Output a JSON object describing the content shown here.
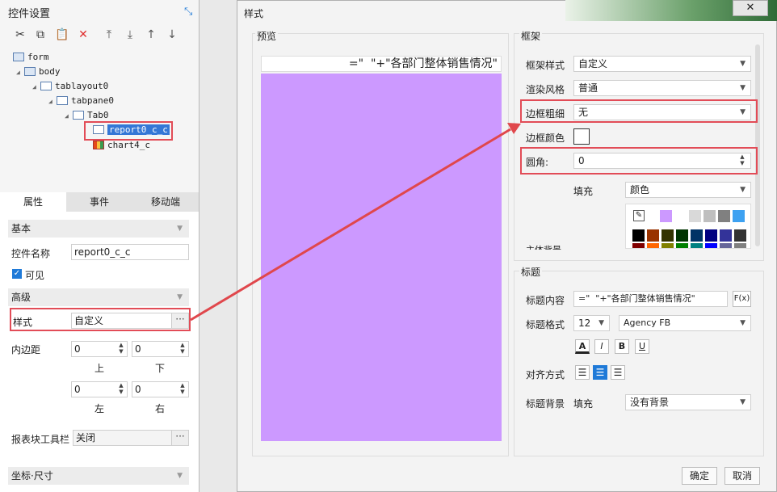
{
  "left_panel": {
    "title": "控件设置",
    "toolbar": [
      "cut",
      "copy",
      "paste",
      "delete",
      "move-top",
      "move-bottom",
      "move-up",
      "move-down"
    ],
    "tree": [
      {
        "label": "form"
      },
      {
        "label": "body"
      },
      {
        "label": "tablayout0"
      },
      {
        "label": "tabpane0"
      },
      {
        "label": "Tab0"
      },
      {
        "label": "report0_c_c"
      },
      {
        "label": "chart4_c"
      }
    ],
    "tabs": [
      "属性",
      "事件",
      "移动端"
    ],
    "sections": {
      "basic": "基本",
      "advanced": "高级",
      "coord": "坐标·尺寸"
    },
    "name_label": "控件名称",
    "name_value": "report0_c_c",
    "visible_label": "可见",
    "style_label": "样式",
    "style_value": "自定义",
    "padding_label": "内边距",
    "padding": {
      "top": "0",
      "bottom": "0",
      "left": "0",
      "right": "0"
    },
    "padding_labels": {
      "top": "上",
      "bottom": "下",
      "left": "左",
      "right": "右"
    },
    "toolbar_label": "报表块工具栏",
    "toolbar_value": "关闭",
    "dots": "···"
  },
  "dialog": {
    "title": "样式",
    "close": "✕",
    "preview": {
      "label": "预览",
      "title_text": "=\"  \"+\"各部门整体销售情况\"",
      "fill": "#cc99ff"
    },
    "frame": {
      "label": "框架",
      "frame_style_label": "框架样式",
      "frame_style_value": "自定义",
      "render_label": "渲染风格",
      "render_value": "普通",
      "border_width_label": "边框粗细",
      "border_width_value": "无",
      "border_color_label": "边框颜色",
      "radius_label": "圆角:",
      "radius_value": "0",
      "fill_label": "填充",
      "fill_value": "颜色",
      "bg_label": "主体背景"
    },
    "title_section": {
      "label": "标题",
      "content_label": "标题内容",
      "content_value": "=\"  \"+\"各部门整体销售情况\"",
      "fx": "F(x)",
      "format_label": "标题格式",
      "font_size": "12",
      "font_name": "Agency FB",
      "font_buttons": [
        "A",
        "I",
        "B",
        "U"
      ],
      "align_label": "对齐方式",
      "bg_label": "标题背景",
      "bg_fill_label": "填充",
      "bg_value": "没有背景"
    },
    "ok": "确定",
    "cancel": "取消"
  },
  "palette_row1": [
    "#cc99ff",
    "#ffffff",
    "#d9d9d9",
    "#bfbfbf",
    "#808080",
    "#3da1f1"
  ],
  "palette_rows": [
    [
      "#000000",
      "#993300",
      "#333300",
      "#003300",
      "#003366",
      "#000080",
      "#333399",
      "#333333"
    ],
    [
      "#800000",
      "#ff6600",
      "#808000",
      "#008000",
      "#008080",
      "#0000ff",
      "#666699",
      "#808080"
    ],
    [
      "#b30000",
      "#cc6600",
      "#999900",
      "#339966",
      "#33cccc",
      "#3366ff",
      "#800080",
      "#969696"
    ]
  ]
}
